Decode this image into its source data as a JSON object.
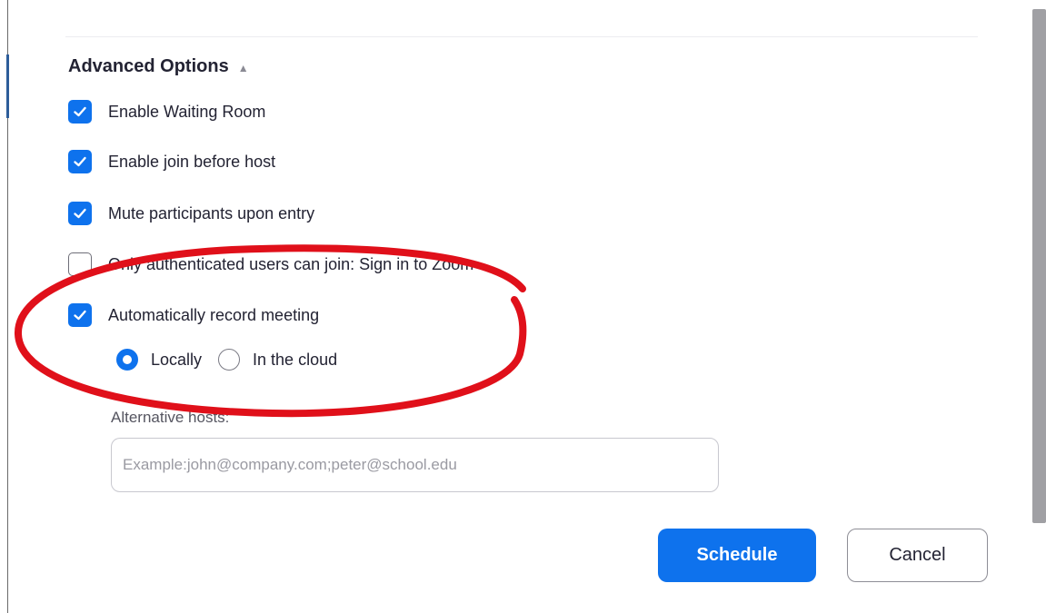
{
  "advanced_options": {
    "title": "Advanced Options",
    "caret_icon": "chevron-up-icon"
  },
  "options": [
    {
      "label": "Enable Waiting Room",
      "checked": true
    },
    {
      "label": "Enable join before host",
      "checked": true
    },
    {
      "label": "Mute participants upon entry",
      "checked": true
    },
    {
      "label": "Only authenticated users can join: Sign in to Zoom",
      "checked": false
    },
    {
      "label": "Automatically record meeting",
      "checked": true
    }
  ],
  "recording": {
    "locally_label": "Locally",
    "cloud_label": "In the cloud",
    "selected": "Locally"
  },
  "alternative_hosts": {
    "label": "Alternative hosts:",
    "placeholder": "Example:john@company.com;peter@school.edu",
    "value": ""
  },
  "buttons": {
    "schedule": "Schedule",
    "cancel": "Cancel"
  },
  "colors": {
    "accent": "#0e72ed",
    "annotation": "#e0101a"
  }
}
